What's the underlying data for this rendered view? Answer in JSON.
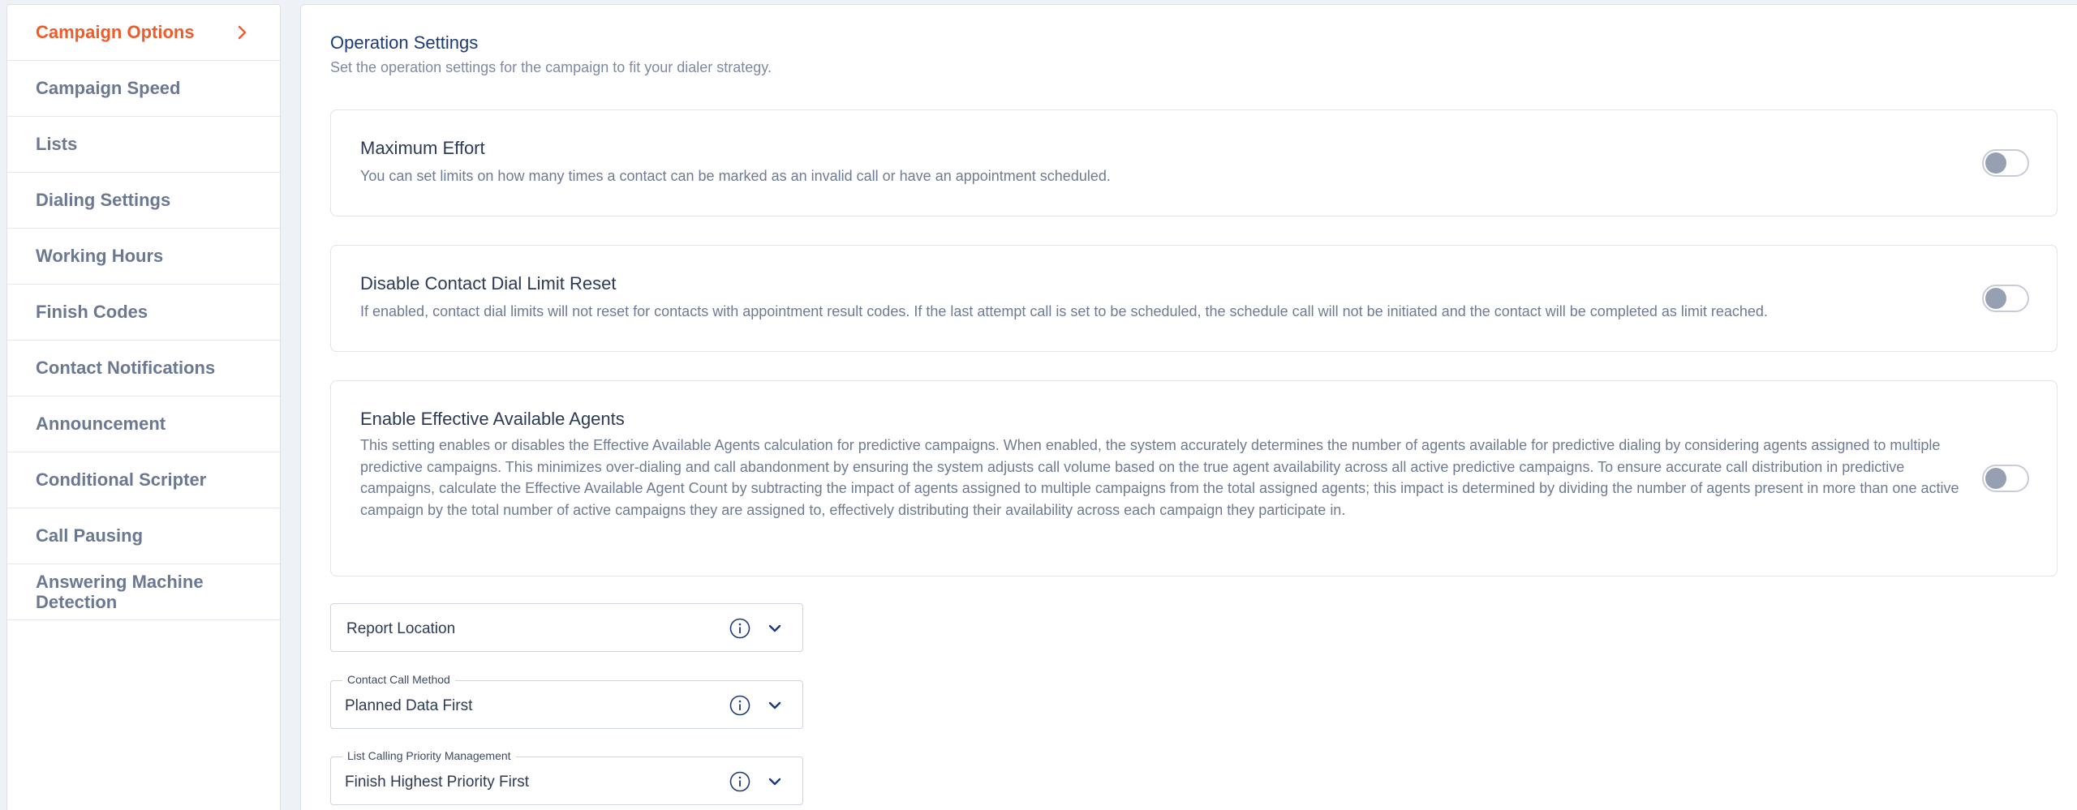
{
  "sidebar": {
    "items": [
      {
        "label": "Campaign Options",
        "active": true
      },
      {
        "label": "Campaign Speed"
      },
      {
        "label": "Lists"
      },
      {
        "label": "Dialing Settings"
      },
      {
        "label": "Working Hours"
      },
      {
        "label": "Finish Codes"
      },
      {
        "label": "Contact Notifications"
      },
      {
        "label": "Announcement"
      },
      {
        "label": "Conditional Scripter"
      },
      {
        "label": "Call Pausing"
      },
      {
        "label": "Answering Machine Detection"
      }
    ],
    "active_icon": "chevron-right-icon"
  },
  "main": {
    "title": "Operation Settings",
    "subtitle": "Set the operation settings for the campaign to fit your dialer strategy.",
    "cards": [
      {
        "title": "Maximum Effort",
        "description": "You can set limits on how many times a contact can be marked as an invalid call or have an appointment scheduled.",
        "toggle_on": false
      },
      {
        "title": "Disable Contact Dial Limit Reset",
        "description": "If enabled, contact dial limits will not reset for contacts with appointment result codes. If the last attempt call is set to be scheduled, the schedule call will not be initiated and the contact will be completed as limit reached.",
        "toggle_on": false
      },
      {
        "title": "Enable Effective Available Agents",
        "description": "This setting enables or disables the Effective Available Agents calculation for predictive campaigns. When enabled, the system accurately determines the number of agents available for predictive dialing by considering agents assigned to multiple predictive campaigns. This minimizes over-dialing and call abandonment by ensuring the system adjusts call volume based on the true agent availability across all active predictive campaigns. To ensure accurate call distribution in predictive campaigns, calculate the Effective Available Agent Count by subtracting the impact of agents assigned to multiple campaigns from the total assigned agents; this impact is determined by dividing the number of agents present in more than one active campaign by the total number of active campaigns they are assigned to, effectively distributing their availability across each campaign they participate in.",
        "toggle_on": false
      }
    ],
    "selects": [
      {
        "label": "",
        "value": "Report Location",
        "placeholder": true
      },
      {
        "label": "Contact Call Method",
        "value": "Planned Data First"
      },
      {
        "label": "List Calling Priority Management",
        "value": "Finish Highest Priority First"
      }
    ]
  },
  "colors": {
    "accent": "#ef5b2a",
    "title": "#1d3a78",
    "text": "#6b7891",
    "toggle_knob": "#97a0b3"
  }
}
